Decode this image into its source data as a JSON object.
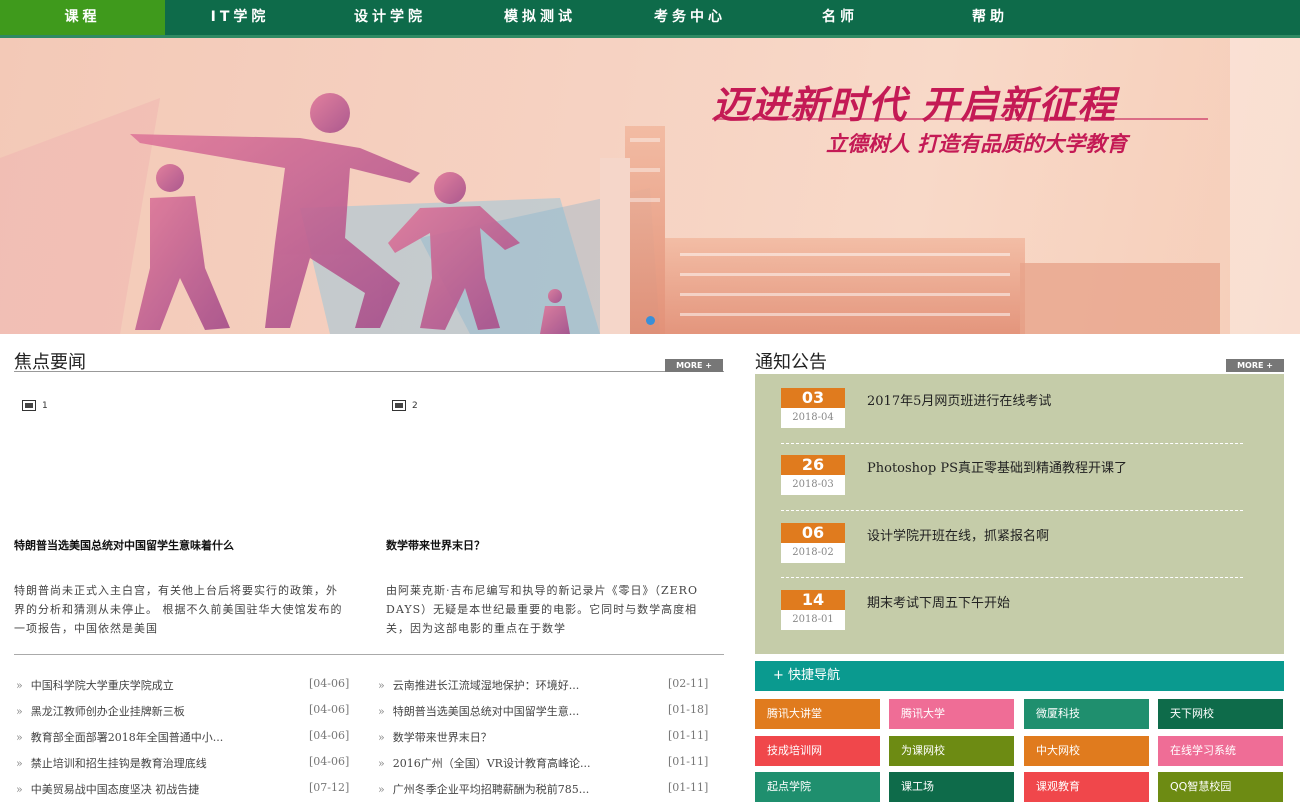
{
  "nav": {
    "items": [
      {
        "label": "课程"
      },
      {
        "label": "IT学院"
      },
      {
        "label": "设计学院"
      },
      {
        "label": "模拟测试"
      },
      {
        "label": "考务中心"
      },
      {
        "label": "名师"
      },
      {
        "label": "帮助"
      }
    ]
  },
  "banner": {
    "title": "迈进新时代 开启新征程",
    "subtitle": "立德树人 打造有品质的大学教育"
  },
  "focus": {
    "title": "焦点要闻",
    "more": "MORE +",
    "images": [
      {
        "alt": "1"
      },
      {
        "alt": "2"
      }
    ],
    "articles": [
      {
        "headline": "特朗普当选美国总统对中国留学生意味着什么",
        "summary": "特朗普尚未正式入主白宫，有关他上台后将要实行的政策，外界的分析和猜测从未停止。 根据不久前美国驻华大使馆发布的一项报告，中国依然是美国"
      },
      {
        "headline": "数学带来世界末日？",
        "summary": "由阿莱克斯·吉布尼编写和执导的新记录片《零日》（ZERO DAYS）无疑是本世纪最重要的电影。它同时与数学高度相关，因为这部电影的重点在于数学"
      }
    ],
    "list_left": [
      {
        "title": "中国科学院大学重庆学院成立",
        "date": "[04-06]"
      },
      {
        "title": "黑龙江教师创办企业挂牌新三板",
        "date": "[04-06]"
      },
      {
        "title": "教育部全面部署2018年全国普通中小...",
        "date": "[04-06]"
      },
      {
        "title": "禁止培训和招生挂钩是教育治理底线",
        "date": "[04-06]"
      },
      {
        "title": "中美贸易战中国态度坚决 初战告捷",
        "date": "[07-12]"
      }
    ],
    "list_right": [
      {
        "title": "云南推进长江流域湿地保护：环境好...",
        "date": "[02-11]"
      },
      {
        "title": "特朗普当选美国总统对中国留学生意...",
        "date": "[01-18]"
      },
      {
        "title": "数学带来世界末日？",
        "date": "[01-11]"
      },
      {
        "title": "2016广州（全国）VR设计教育高峰论...",
        "date": "[01-11]"
      },
      {
        "title": "广州冬季企业平均招聘薪酬为税前785...",
        "date": "[01-11]"
      }
    ]
  },
  "notices": {
    "title": "通知公告",
    "more": "MORE +",
    "items": [
      {
        "day": "03",
        "ym": "2018-04",
        "text": "2017年5月网页班进行在线考试"
      },
      {
        "day": "26",
        "ym": "2018-03",
        "text": "Photoshop PS真正零基础到精通教程开课了"
      },
      {
        "day": "06",
        "ym": "2018-02",
        "text": "设计学院开班在线，抓紧报名啊"
      },
      {
        "day": "14",
        "ym": "2018-01",
        "text": "期末考试下周五下午开始"
      }
    ]
  },
  "quick_nav": {
    "title": "+ 快捷导航",
    "links": [
      {
        "label": "腾讯大讲堂",
        "color": "#e07b1e"
      },
      {
        "label": "腾讯大学",
        "color": "#ef6d96"
      },
      {
        "label": "微厦科技",
        "color": "#1f8f6e"
      },
      {
        "label": "天下网校",
        "color": "#0e6b4a"
      },
      {
        "label": "技成培训网",
        "color": "#f0474b"
      },
      {
        "label": "为课网校",
        "color": "#6d8b13"
      },
      {
        "label": "中大网校",
        "color": "#e07b1e"
      },
      {
        "label": "在线学习系统",
        "color": "#ef6d96"
      },
      {
        "label": "起点学院",
        "color": "#1f8f6e"
      },
      {
        "label": "课工场",
        "color": "#0e6b4a"
      },
      {
        "label": "课观教育",
        "color": "#f0474b"
      },
      {
        "label": "QQ智慧校园",
        "color": "#6d8b13"
      }
    ]
  }
}
